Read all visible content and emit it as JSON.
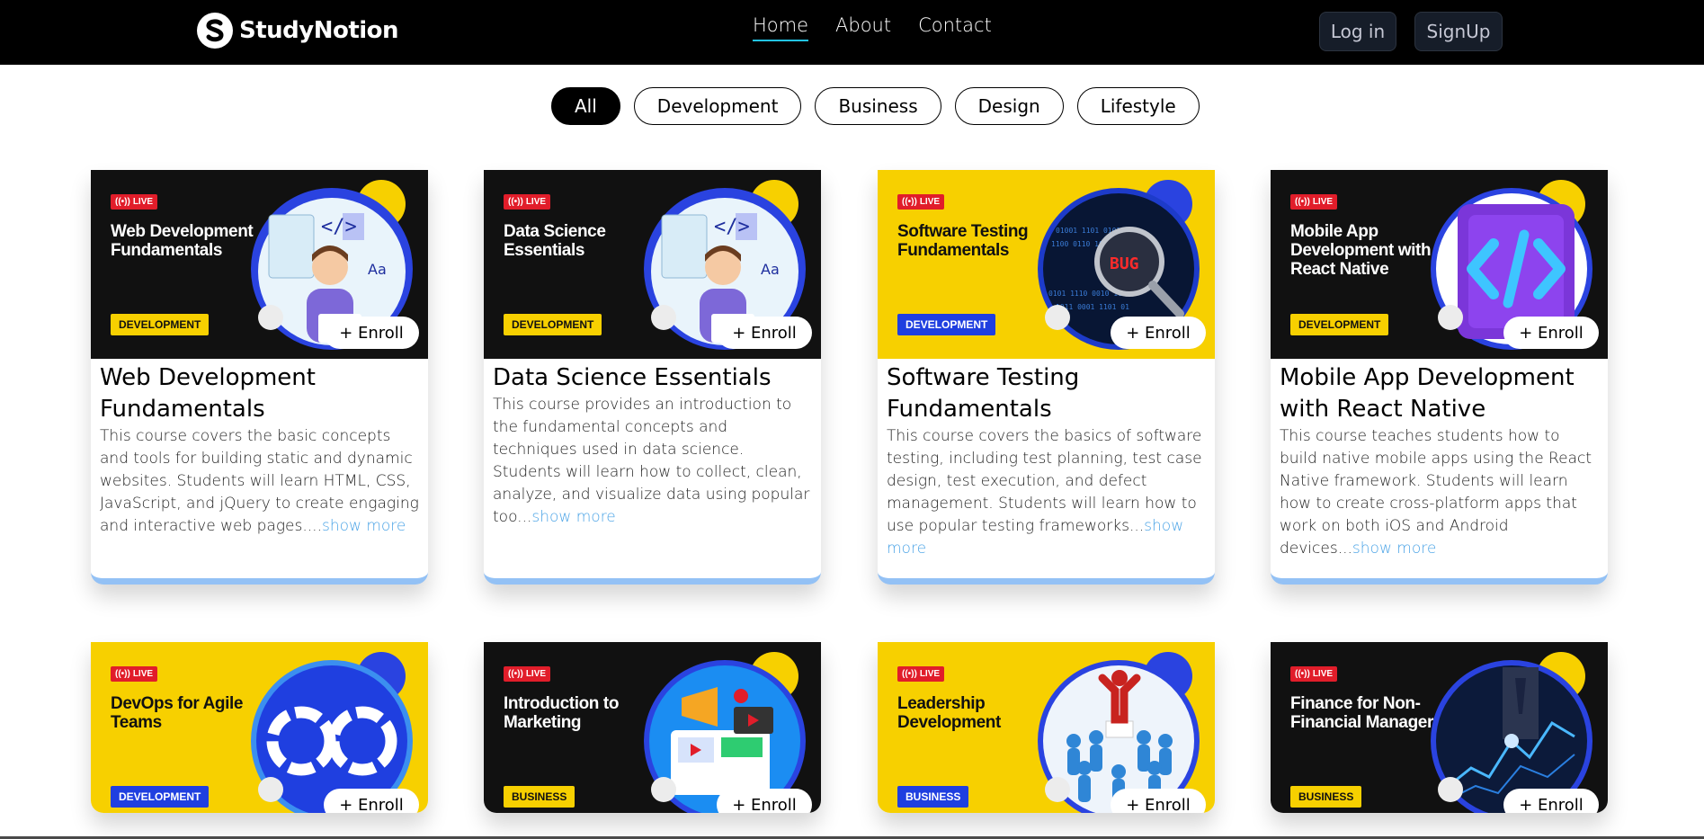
{
  "brand": {
    "name": "StudyNotion"
  },
  "nav": {
    "links": [
      "Home",
      "About",
      "Contact"
    ],
    "active": "Home"
  },
  "auth": {
    "login": "Log in",
    "signup": "SignUp"
  },
  "filters": [
    "All",
    "Development",
    "Business",
    "Design",
    "Lifestyle"
  ],
  "active_filter": "All",
  "live_label": "LIVE",
  "enroll_label": "+ Enroll",
  "show_more_label": "show more",
  "colors": {
    "accent_blue": "#93c1f5",
    "tag_yellow": "#f7d000",
    "tag_blue": "#1f3fe0",
    "live_red": "#e11d2a",
    "link": "#4aa3e6"
  },
  "courses": [
    {
      "thumb_title": "Web Development Fundamentals",
      "category": "DEVELOPMENT",
      "title": "Web Development Fundamentals",
      "description": "This course covers the basic concepts and tools for building static and dynamic websites. Students will learn HTML, CSS, JavaScript, and jQuery to create engaging and interactive web pages....",
      "theme": "dark",
      "art": "developer-illustration"
    },
    {
      "thumb_title": "Data Science Essentials",
      "category": "DEVELOPMENT",
      "title": "Data Science Essentials",
      "description": "This course provides an introduction to the fundamental concepts and techniques used in data science. Students will learn how to collect, clean, analyze, and visualize data using popular too...",
      "theme": "dark",
      "art": "developer-illustration"
    },
    {
      "thumb_title": "Software Testing Fundamentals",
      "category": "DEVELOPMENT",
      "title": "Software Testing Fundamentals",
      "description": "This course covers the basics of software testing, including test planning, test case design, test execution, and defect management. Students will learn how to use popular testing frameworks...",
      "theme": "yellow",
      "art": "bug-magnifier"
    },
    {
      "thumb_title": "Mobile App Development with React Native",
      "category": "DEVELOPMENT",
      "title": "Mobile App Development with React Native",
      "description": "This course teaches students how to build native mobile apps using the React Native framework. Students will learn how to create cross-platform apps that work on both iOS and Android devices...",
      "theme": "dark",
      "art": "code-symbol"
    },
    {
      "thumb_title": "DevOps for Agile Teams",
      "category": "DEVELOPMENT",
      "theme": "yellow",
      "art": "devops-loop"
    },
    {
      "thumb_title": "Introduction to Marketing",
      "category": "BUSINESS",
      "theme": "dark",
      "art": "marketing-megaphone"
    },
    {
      "thumb_title": "Leadership Development",
      "category": "BUSINESS",
      "theme": "yellow",
      "art": "leader-crowd"
    },
    {
      "thumb_title": "Finance for Non-Financial Managers",
      "category": "BUSINESS",
      "theme": "dark",
      "art": "finance-chart"
    }
  ]
}
